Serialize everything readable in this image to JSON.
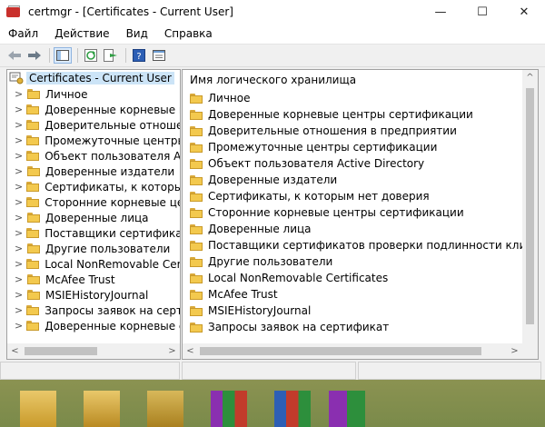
{
  "window": {
    "title": "certmgr - [Certificates - Current User]",
    "controls": {
      "minimize": "—",
      "maximize": "☐",
      "close": "✕"
    }
  },
  "menu": [
    "Файл",
    "Действие",
    "Вид",
    "Справка"
  ],
  "tree": {
    "root": "Certificates - Current User",
    "items": [
      "Личное",
      "Доверенные корневые цент",
      "Доверительные отношения",
      "Промежуточные центры се",
      "Объект пользователя Active",
      "Доверенные издатели",
      "Сертификаты, к которым не",
      "Сторонние корневые центр",
      "Доверенные лица",
      "Поставщики сертификатов",
      "Другие пользователи",
      "Local NonRemovable Certific",
      "McAfee Trust",
      "MSIEHistoryJournal",
      "Запросы заявок на сертифи",
      "Доверенные корневые серт"
    ]
  },
  "list": {
    "column_header": "Имя логического хранилища",
    "items": [
      "Личное",
      "Доверенные корневые центры сертификации",
      "Доверительные отношения в предприятии",
      "Промежуточные центры сертификации",
      "Объект пользователя Active Directory",
      "Доверенные издатели",
      "Сертификаты, к которым нет доверия",
      "Сторонние корневые центры сертификации",
      "Доверенные лица",
      "Поставщики сертификатов проверки подлинности клиентов",
      "Другие пользователи",
      "Local NonRemovable Certificates",
      "McAfee Trust",
      "MSIEHistoryJournal",
      "Запросы заявок на сертификат"
    ]
  },
  "scroll_arrows": {
    "left": "<",
    "right": ">",
    "up": "^",
    "down": "v"
  }
}
